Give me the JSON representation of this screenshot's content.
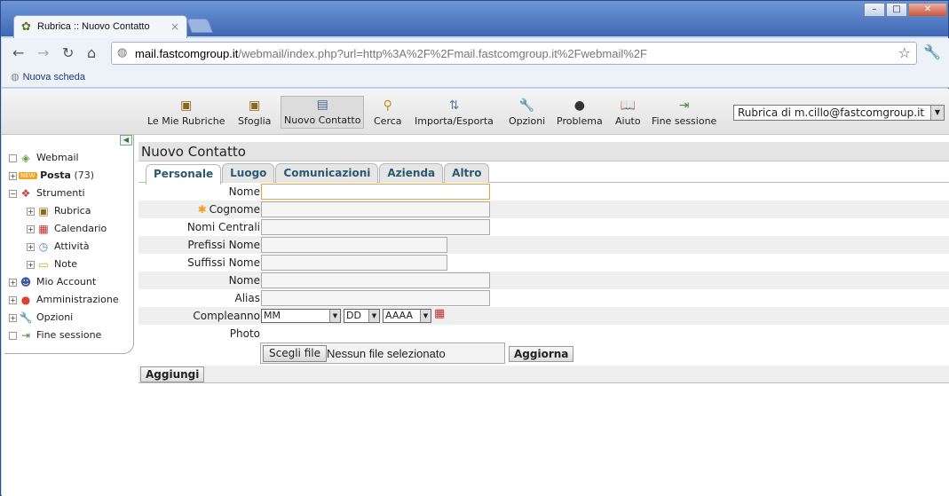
{
  "browser": {
    "tab_title": "Rubrica :: Nuovo Contatto",
    "tab_close": "×",
    "url_host": "mail.fastcomgroup.it",
    "url_path": "/webmail/index.php?url=http%3A%2F%2Fmail.fastcomgroup.it%2Fwebmail%2F",
    "bookmark": "Nuova scheda",
    "win_min": "–",
    "win_max": "□",
    "win_close": "✕"
  },
  "toolbar": {
    "items": [
      {
        "label": "Le Mie Rubriche",
        "icon": "address-books-icon"
      },
      {
        "label": "Sfoglia",
        "icon": "browse-icon"
      },
      {
        "label": "Nuovo Contatto",
        "icon": "new-contact-icon"
      },
      {
        "label": "Cerca",
        "icon": "search-icon"
      },
      {
        "label": "Importa/Esporta",
        "icon": "import-export-icon"
      },
      {
        "label": "Opzioni",
        "icon": "options-icon"
      },
      {
        "label": "Problema",
        "icon": "problem-icon"
      },
      {
        "label": "Aiuto",
        "icon": "help-icon"
      },
      {
        "label": "Fine sessione",
        "icon": "logout-icon"
      }
    ],
    "book_selector": "Rubrica di m.cillo@fastcomgroup.it"
  },
  "sidebar": {
    "items": [
      {
        "label": "Webmail",
        "count": ""
      },
      {
        "label": "Posta",
        "count": "(73)",
        "badge": "NEW"
      },
      {
        "label": "Strumenti",
        "count": ""
      },
      {
        "label": "Rubrica",
        "count": ""
      },
      {
        "label": "Calendario",
        "count": ""
      },
      {
        "label": "Attività",
        "count": ""
      },
      {
        "label": "Note",
        "count": ""
      },
      {
        "label": "Mio Account",
        "count": ""
      },
      {
        "label": "Amministrazione",
        "count": ""
      },
      {
        "label": "Opzioni",
        "count": ""
      },
      {
        "label": "Fine sessione",
        "count": ""
      }
    ]
  },
  "content": {
    "title": "Nuovo Contatto",
    "tabs": [
      "Personale",
      "Luogo",
      "Comunicazioni",
      "Azienda",
      "Altro"
    ],
    "fields": {
      "nome": "Nome",
      "cognome": "Cognome",
      "nomi_centrali": "Nomi Centrali",
      "prefissi": "Prefissi Nome",
      "suffissi": "Suffissi Nome",
      "nome2": "Nome",
      "alias": "Alias",
      "compleanno": "Compleanno",
      "photo": "Photo"
    },
    "birthday": {
      "month": "MM",
      "day": "DD",
      "year": "AAAA"
    },
    "file_button": "Scegli file",
    "file_status": "Nessun file selezionato",
    "update_button": "Aggiorna",
    "add_button": "Aggiungi"
  }
}
